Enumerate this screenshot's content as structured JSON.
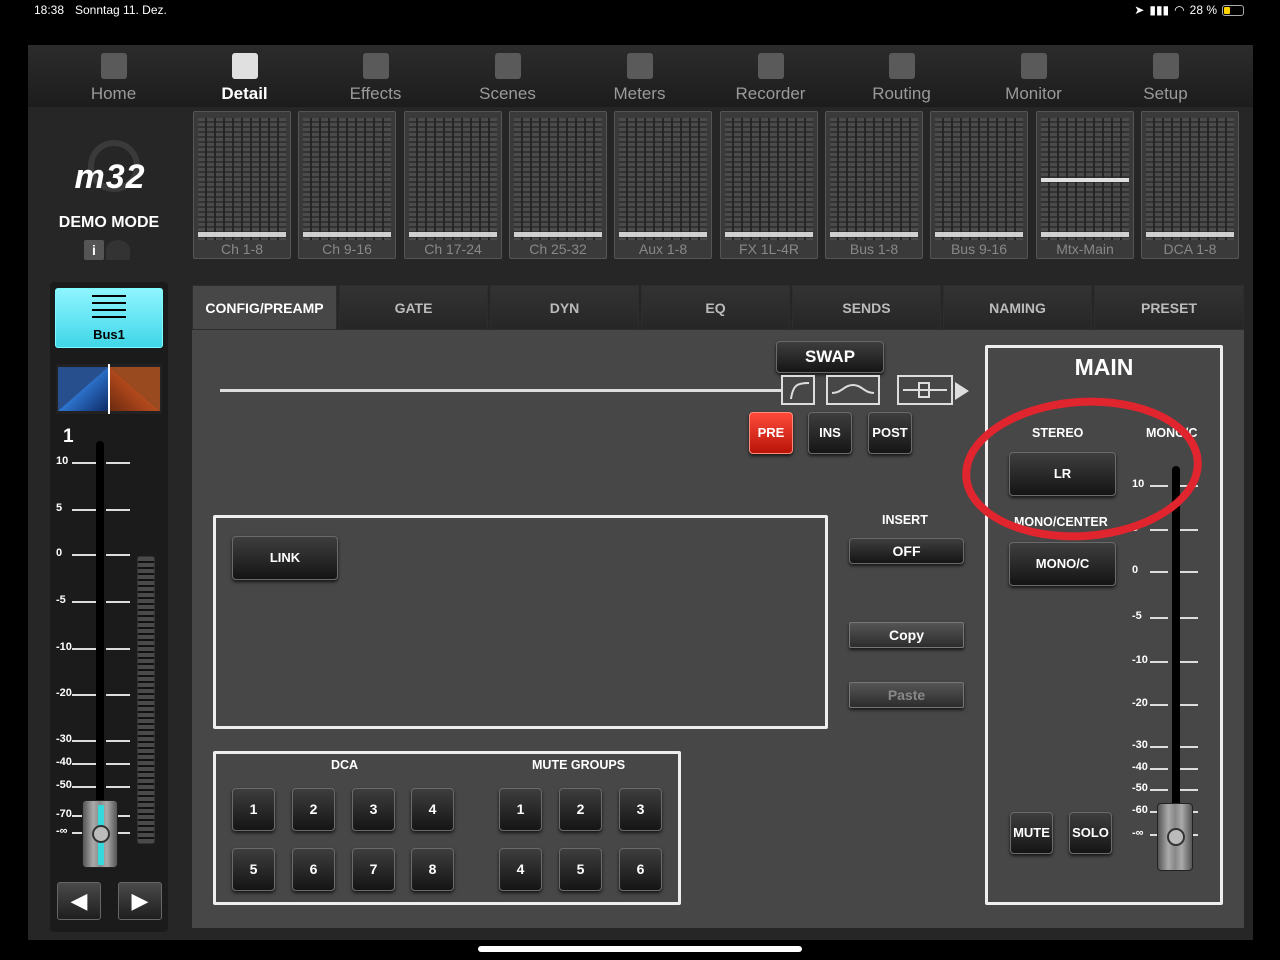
{
  "status": {
    "time": "18:38",
    "date": "Sonntag 11. Dez.",
    "battery": "28 %"
  },
  "nav": {
    "items": [
      {
        "label": "Home",
        "icon": "home-icon"
      },
      {
        "label": "Detail",
        "icon": "detail-icon"
      },
      {
        "label": "Effects",
        "icon": "effects-icon"
      },
      {
        "label": "Scenes",
        "icon": "scenes-icon"
      },
      {
        "label": "Meters",
        "icon": "meters-icon"
      },
      {
        "label": "Recorder",
        "icon": "recorder-icon"
      },
      {
        "label": "Routing",
        "icon": "routing-icon"
      },
      {
        "label": "Monitor",
        "icon": "headphones-icon"
      },
      {
        "label": "Setup",
        "icon": "gear-icon"
      }
    ],
    "active": "Detail"
  },
  "sidebar": {
    "logo": "m32",
    "mode": "DEMO MODE",
    "info": "i",
    "channel_button": "Bus1",
    "channel_number": "1",
    "fader_scale": [
      "10",
      "5",
      "0",
      "-5",
      "-10",
      "-20",
      "-30",
      "-40",
      "-50",
      "-70",
      "-∞"
    ],
    "prev": "◀",
    "next": "▶"
  },
  "banks": [
    "Ch 1-8",
    "Ch 9-16",
    "Ch 17-24",
    "Ch 25-32",
    "Aux 1-8",
    "FX 1L-4R",
    "Bus 1-8",
    "Bus 9-16",
    "Mtx-Main",
    "DCA 1-8"
  ],
  "tabs": [
    "CONFIG/PREAMP",
    "GATE",
    "DYN",
    "EQ",
    "SENDS",
    "NAMING",
    "PRESET"
  ],
  "active_tab": "CONFIG/PREAMP",
  "config": {
    "swap": "SWAP",
    "pre": "PRE",
    "ins": "INS",
    "post": "POST",
    "link": "LINK",
    "insert_label": "INSERT",
    "insert_value": "OFF",
    "copy": "Copy",
    "paste": "Paste",
    "dca_label": "DCA",
    "dca_buttons": [
      "1",
      "2",
      "3",
      "4",
      "5",
      "6",
      "7",
      "8"
    ],
    "mute_groups_label": "MUTE GROUPS",
    "mute_group_buttons": [
      "1",
      "2",
      "3",
      "4",
      "5",
      "6"
    ]
  },
  "main": {
    "title": "MAIN",
    "stereo_label": "STEREO",
    "lr": "LR",
    "mono_c_label": "MONO/C",
    "mono_center_label": "MONO/CENTER",
    "mono_c_button": "MONO/C",
    "mute": "MUTE",
    "solo": "SOLO",
    "fader_scale": [
      "10",
      "5",
      "0",
      "-5",
      "-10",
      "-20",
      "-30",
      "-40",
      "-50",
      "-60",
      "-∞"
    ]
  },
  "colors": {
    "accent_cyan": "#3fd6e8",
    "pre_red": "#e0252f",
    "annotation_red": "#e0252f"
  }
}
